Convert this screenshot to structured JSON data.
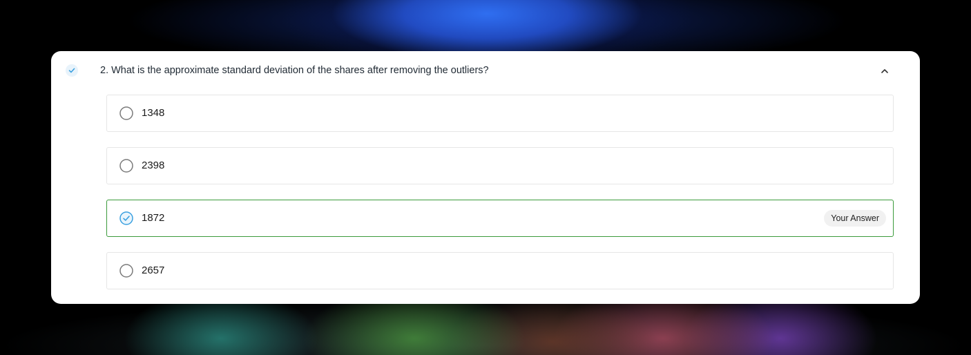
{
  "question": {
    "title": "2. What is the approximate standard deviation of the shares after removing the outliers?",
    "status_icon": "check-icon",
    "collapse_icon": "chevron-up-icon"
  },
  "options": [
    {
      "label": "1348",
      "selected": false
    },
    {
      "label": "2398",
      "selected": false
    },
    {
      "label": "1872",
      "selected": true,
      "badge": "Your Answer"
    },
    {
      "label": "2657",
      "selected": false
    }
  ],
  "colors": {
    "selected_border": "#3a9a3a",
    "check_blue": "#3aa0e0",
    "radio_gray": "#7a7a7a"
  }
}
